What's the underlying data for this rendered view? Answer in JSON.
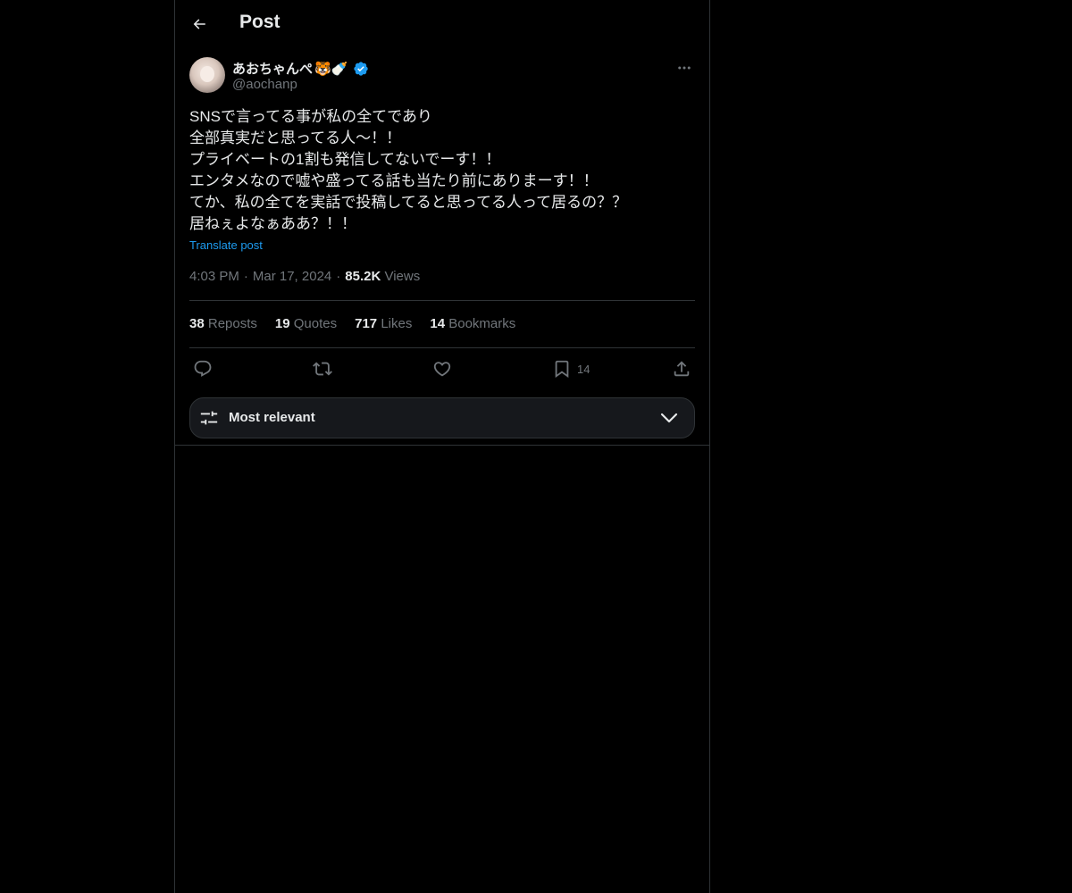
{
  "header": {
    "title": "Post"
  },
  "author": {
    "display_name": "あおちゃんぺ",
    "name_emojis": "🐯🍼",
    "handle": "@aochanp"
  },
  "post": {
    "lines": [
      "SNSで言ってる事が私の全てであり",
      "全部真実だと思ってる人〜！！",
      "プライベートの1割も発信してないでーす！！",
      "エンタメなので嘘や盛ってる話も当たり前にありまーす！！",
      "てか、私の全てを実話で投稿してると思ってる人って居るの？？",
      "居ねぇよなぁああ？！！"
    ],
    "translate_label": "Translate post",
    "time": "4:03 PM",
    "date": "Mar 17, 2024",
    "views_count": "85.2K",
    "views_label": "Views"
  },
  "stats": {
    "reposts": {
      "count": "38",
      "label": "Reposts"
    },
    "quotes": {
      "count": "19",
      "label": "Quotes"
    },
    "likes": {
      "count": "717",
      "label": "Likes"
    },
    "bookmarks": {
      "count": "14",
      "label": "Bookmarks"
    }
  },
  "actions": {
    "bookmark_count": "14"
  },
  "sort": {
    "label": "Most relevant"
  },
  "colors": {
    "background": "#000000",
    "text": "#e7e9ea",
    "secondary_text": "#71767b",
    "accent": "#1d9bf0",
    "border": "#2f3336"
  }
}
